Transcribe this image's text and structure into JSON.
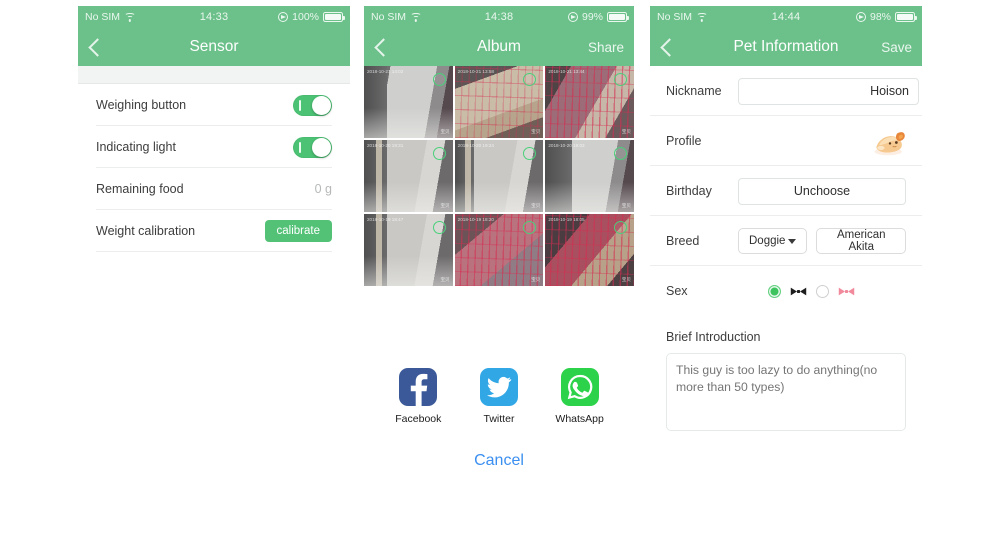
{
  "theme": {
    "header_green": "#6cc08a",
    "accent_green": "#4cc274",
    "link_blue": "#3b8ff0"
  },
  "panel1": {
    "status": {
      "carrier": "No SIM",
      "wifi_icon": "wifi-icon",
      "time": "14:33",
      "location_icon": "location-arrow-icon",
      "battery_text": "100%",
      "battery_icon": "battery-full-icon"
    },
    "nav": {
      "back_icon": "back-chevron-icon",
      "title": "Sensor"
    },
    "rows": [
      {
        "label": "Weighing button",
        "control": "toggle",
        "state": "on"
      },
      {
        "label": "Indicating light",
        "control": "toggle",
        "state": "on"
      },
      {
        "label": "Remaining food",
        "control": "value",
        "value": "0 g"
      },
      {
        "label": "Weight calibration",
        "control": "button",
        "value": "calibrate"
      }
    ]
  },
  "panel2": {
    "status": {
      "carrier": "No SIM",
      "wifi_icon": "wifi-icon",
      "time": "14:38",
      "location_icon": "location-arrow-icon",
      "battery_text": "99%",
      "battery_icon": "battery-full-icon"
    },
    "nav": {
      "back_icon": "back-chevron-icon",
      "title": "Album",
      "action": "Share"
    },
    "thumbnails": [
      {
        "scene": "sc-hall",
        "timestamp": "2018-10-21 14:02",
        "tag": "宝贝",
        "selected": false
      },
      {
        "scene": "sc-dog",
        "timestamp": "2018-10-21 13:58",
        "tag": "宝贝",
        "selected": false
      },
      {
        "scene": "sc-cage",
        "timestamp": "2018-10-21 13:44",
        "tag": "宝贝",
        "selected": false
      },
      {
        "scene": "sc-hall2",
        "timestamp": "2018-10-20 19:31",
        "tag": "宝贝",
        "selected": false
      },
      {
        "scene": "sc-hall2",
        "timestamp": "2018-10-20 19:24",
        "tag": "宝贝",
        "selected": false
      },
      {
        "scene": "sc-hall",
        "timestamp": "2018-10-20 19:03",
        "tag": "宝贝",
        "selected": false
      },
      {
        "scene": "sc-hall2",
        "timestamp": "2018-10-19 18:47",
        "tag": "宝贝",
        "selected": false
      },
      {
        "scene": "sc-cage2",
        "timestamp": "2018-10-19 18:20",
        "tag": "宝贝",
        "selected": false
      },
      {
        "scene": "sc-cage3",
        "timestamp": "2018-10-19 18:05",
        "tag": "宝贝",
        "selected": false
      }
    ],
    "share_sheet": {
      "items": [
        {
          "label": "Facebook",
          "icon": "facebook-icon",
          "color": "#3b5998"
        },
        {
          "label": "Twitter",
          "icon": "twitter-icon",
          "color": "#32a7e6"
        },
        {
          "label": "WhatsApp",
          "icon": "whatsapp-icon",
          "color": "#2bd24a"
        }
      ],
      "cancel_label": "Cancel"
    }
  },
  "panel3": {
    "status": {
      "carrier": "No SIM",
      "wifi_icon": "wifi-icon",
      "time": "14:44",
      "location_icon": "location-arrow-icon",
      "battery_text": "98%",
      "battery_icon": "battery-full-icon"
    },
    "nav": {
      "back_icon": "back-chevron-icon",
      "title": "Pet Information",
      "action": "Save"
    },
    "nickname": {
      "label": "Nickname",
      "value": "Hoison",
      "placeholder": "Nickname"
    },
    "profile": {
      "label": "Profile",
      "avatar_icon": "dog-avatar-icon"
    },
    "birthday": {
      "label": "Birthday",
      "value": "Unchoose"
    },
    "breed": {
      "label": "Breed",
      "type_value": "Doggie",
      "caret_icon": "caret-down-icon",
      "breed_value": "American Akita"
    },
    "sex": {
      "label": "Sex",
      "options": [
        {
          "icon": "male-bowtie-icon",
          "selected": true
        },
        {
          "icon": "female-bowtie-icon",
          "selected": false
        }
      ]
    },
    "introduction": {
      "label": "Brief Introduction",
      "placeholder": "This guy is too lazy to do anything(no more than 50 types)",
      "value": ""
    }
  }
}
